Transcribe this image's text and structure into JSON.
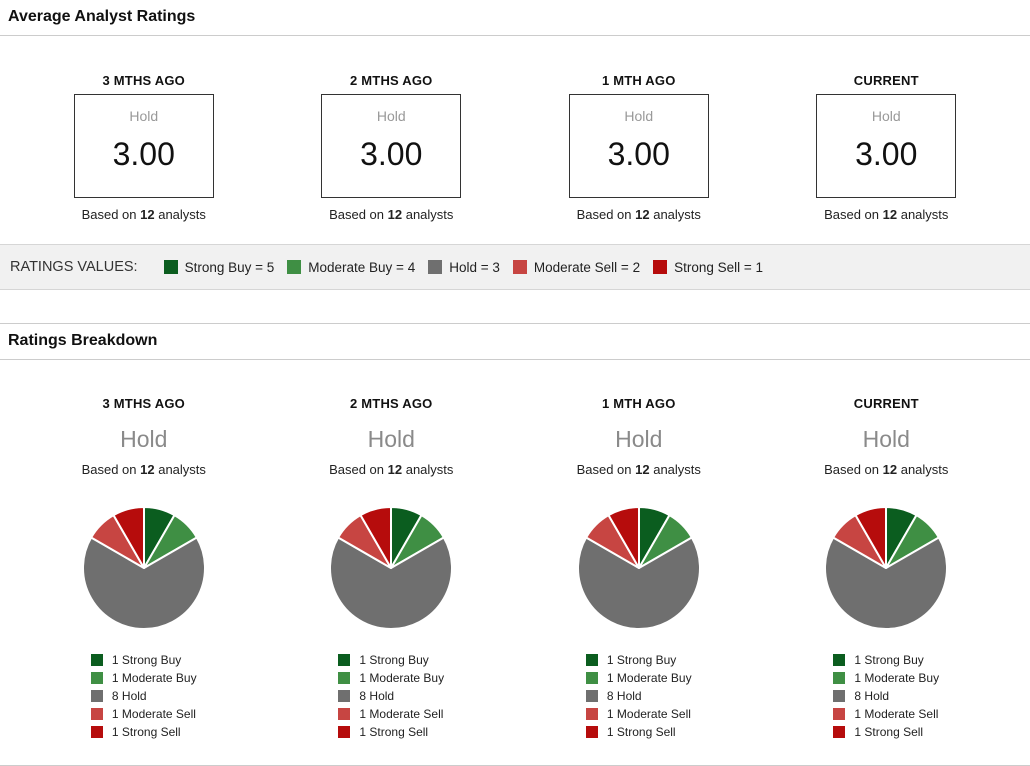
{
  "palette": {
    "strong_buy": "#0b5d1f",
    "moderate_buy": "#3f8f44",
    "hold": "#6f6f6f",
    "moderate_sell": "#c74542",
    "strong_sell": "#b60c0c"
  },
  "summary": {
    "title": "Average Analyst Ratings",
    "columns": [
      {
        "label": "3 MTHS AGO",
        "rating_text": "Hold",
        "rating_value": "3.00",
        "based_on_prefix": "Based on",
        "analyst_count": "12",
        "based_on_suffix": "analysts"
      },
      {
        "label": "2 MTHS AGO",
        "rating_text": "Hold",
        "rating_value": "3.00",
        "based_on_prefix": "Based on",
        "analyst_count": "12",
        "based_on_suffix": "analysts"
      },
      {
        "label": "1 MTH AGO",
        "rating_text": "Hold",
        "rating_value": "3.00",
        "based_on_prefix": "Based on",
        "analyst_count": "12",
        "based_on_suffix": "analysts"
      },
      {
        "label": "CURRENT",
        "rating_text": "Hold",
        "rating_value": "3.00",
        "based_on_prefix": "Based on",
        "analyst_count": "12",
        "based_on_suffix": "analysts"
      }
    ],
    "ratings_values": {
      "label": "RATINGS VALUES:",
      "items": [
        {
          "label": "Strong Buy = 5",
          "color_key": "strong_buy"
        },
        {
          "label": "Moderate Buy = 4",
          "color_key": "moderate_buy"
        },
        {
          "label": "Hold = 3",
          "color_key": "hold"
        },
        {
          "label": "Moderate Sell = 2",
          "color_key": "moderate_sell"
        },
        {
          "label": "Strong Sell = 1",
          "color_key": "strong_sell"
        }
      ]
    }
  },
  "breakdown": {
    "title": "Ratings Breakdown",
    "columns": [
      {
        "label": "3 MTHS AGO",
        "rating_text": "Hold",
        "based_on_prefix": "Based on",
        "analyst_count": "12",
        "based_on_suffix": "analysts",
        "legend": [
          {
            "label": "1 Strong Buy",
            "color_key": "strong_buy"
          },
          {
            "label": "1 Moderate Buy",
            "color_key": "moderate_buy"
          },
          {
            "label": "8 Hold",
            "color_key": "hold"
          },
          {
            "label": "1 Moderate Sell",
            "color_key": "moderate_sell"
          },
          {
            "label": "1 Strong Sell",
            "color_key": "strong_sell"
          }
        ]
      },
      {
        "label": "2 MTHS AGO",
        "rating_text": "Hold",
        "based_on_prefix": "Based on",
        "analyst_count": "12",
        "based_on_suffix": "analysts",
        "legend": [
          {
            "label": "1 Strong Buy",
            "color_key": "strong_buy"
          },
          {
            "label": "1 Moderate Buy",
            "color_key": "moderate_buy"
          },
          {
            "label": "8 Hold",
            "color_key": "hold"
          },
          {
            "label": "1 Moderate Sell",
            "color_key": "moderate_sell"
          },
          {
            "label": "1 Strong Sell",
            "color_key": "strong_sell"
          }
        ]
      },
      {
        "label": "1 MTH AGO",
        "rating_text": "Hold",
        "based_on_prefix": "Based on",
        "analyst_count": "12",
        "based_on_suffix": "analysts",
        "legend": [
          {
            "label": "1 Strong Buy",
            "color_key": "strong_buy"
          },
          {
            "label": "1 Moderate Buy",
            "color_key": "moderate_buy"
          },
          {
            "label": "8 Hold",
            "color_key": "hold"
          },
          {
            "label": "1 Moderate Sell",
            "color_key": "moderate_sell"
          },
          {
            "label": "1 Strong Sell",
            "color_key": "strong_sell"
          }
        ]
      },
      {
        "label": "CURRENT",
        "rating_text": "Hold",
        "based_on_prefix": "Based on",
        "analyst_count": "12",
        "based_on_suffix": "analysts",
        "legend": [
          {
            "label": "1 Strong Buy",
            "color_key": "strong_buy"
          },
          {
            "label": "1 Moderate Buy",
            "color_key": "moderate_buy"
          },
          {
            "label": "8 Hold",
            "color_key": "hold"
          },
          {
            "label": "1 Moderate Sell",
            "color_key": "moderate_sell"
          },
          {
            "label": "1 Strong Sell",
            "color_key": "strong_sell"
          }
        ]
      }
    ]
  },
  "chart_data": [
    {
      "type": "pie",
      "title": "3 MTHS AGO",
      "rating": "Hold",
      "analysts": 12,
      "labels": [
        "Strong Buy",
        "Moderate Buy",
        "Hold",
        "Moderate Sell",
        "Strong Sell"
      ],
      "values": [
        1,
        1,
        8,
        1,
        1
      ],
      "colors": [
        "#0b5d1f",
        "#3f8f44",
        "#6f6f6f",
        "#c74542",
        "#b60c0c"
      ],
      "start_angle_deg": -90,
      "direction": "clockwise",
      "legend_position": "bottom-left"
    },
    {
      "type": "pie",
      "title": "2 MTHS AGO",
      "rating": "Hold",
      "analysts": 12,
      "labels": [
        "Strong Buy",
        "Moderate Buy",
        "Hold",
        "Moderate Sell",
        "Strong Sell"
      ],
      "values": [
        1,
        1,
        8,
        1,
        1
      ],
      "colors": [
        "#0b5d1f",
        "#3f8f44",
        "#6f6f6f",
        "#c74542",
        "#b60c0c"
      ],
      "start_angle_deg": -90,
      "direction": "clockwise",
      "legend_position": "bottom-left"
    },
    {
      "type": "pie",
      "title": "1 MTH AGO",
      "rating": "Hold",
      "analysts": 12,
      "labels": [
        "Strong Buy",
        "Moderate Buy",
        "Hold",
        "Moderate Sell",
        "Strong Sell"
      ],
      "values": [
        1,
        1,
        8,
        1,
        1
      ],
      "colors": [
        "#0b5d1f",
        "#3f8f44",
        "#6f6f6f",
        "#c74542",
        "#b60c0c"
      ],
      "start_angle_deg": -90,
      "direction": "clockwise",
      "legend_position": "bottom-left"
    },
    {
      "type": "pie",
      "title": "CURRENT",
      "rating": "Hold",
      "analysts": 12,
      "labels": [
        "Strong Buy",
        "Moderate Buy",
        "Hold",
        "Moderate Sell",
        "Strong Sell"
      ],
      "values": [
        1,
        1,
        8,
        1,
        1
      ],
      "colors": [
        "#0b5d1f",
        "#3f8f44",
        "#6f6f6f",
        "#c74542",
        "#b60c0c"
      ],
      "start_angle_deg": -90,
      "direction": "clockwise",
      "legend_position": "bottom-left"
    }
  ]
}
